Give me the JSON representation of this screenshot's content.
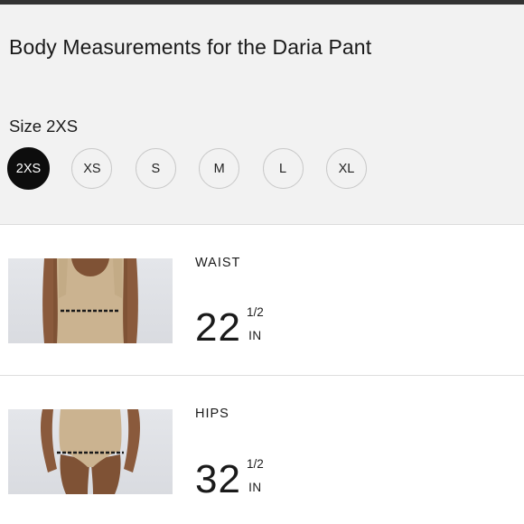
{
  "page": {
    "title": "Body Measurements for the Daria Pant"
  },
  "size_selector": {
    "label": "Size 2XS",
    "selected": "2XS",
    "options": [
      "2XS",
      "XS",
      "S",
      "M",
      "L",
      "XL"
    ]
  },
  "measurements": [
    {
      "name": "WAIST",
      "whole": "22",
      "fraction": "1/2",
      "unit": "IN",
      "image": "waist-measurement-figure"
    },
    {
      "name": "HIPS",
      "whole": "32",
      "fraction": "1/2",
      "unit": "IN",
      "image": "hips-measurement-figure"
    }
  ],
  "colors": {
    "header_bg": "#f2f2f2",
    "selected_size_bg": "#0d0d0d",
    "garment": "#c8b08c",
    "skin": "#8a5a3c"
  }
}
